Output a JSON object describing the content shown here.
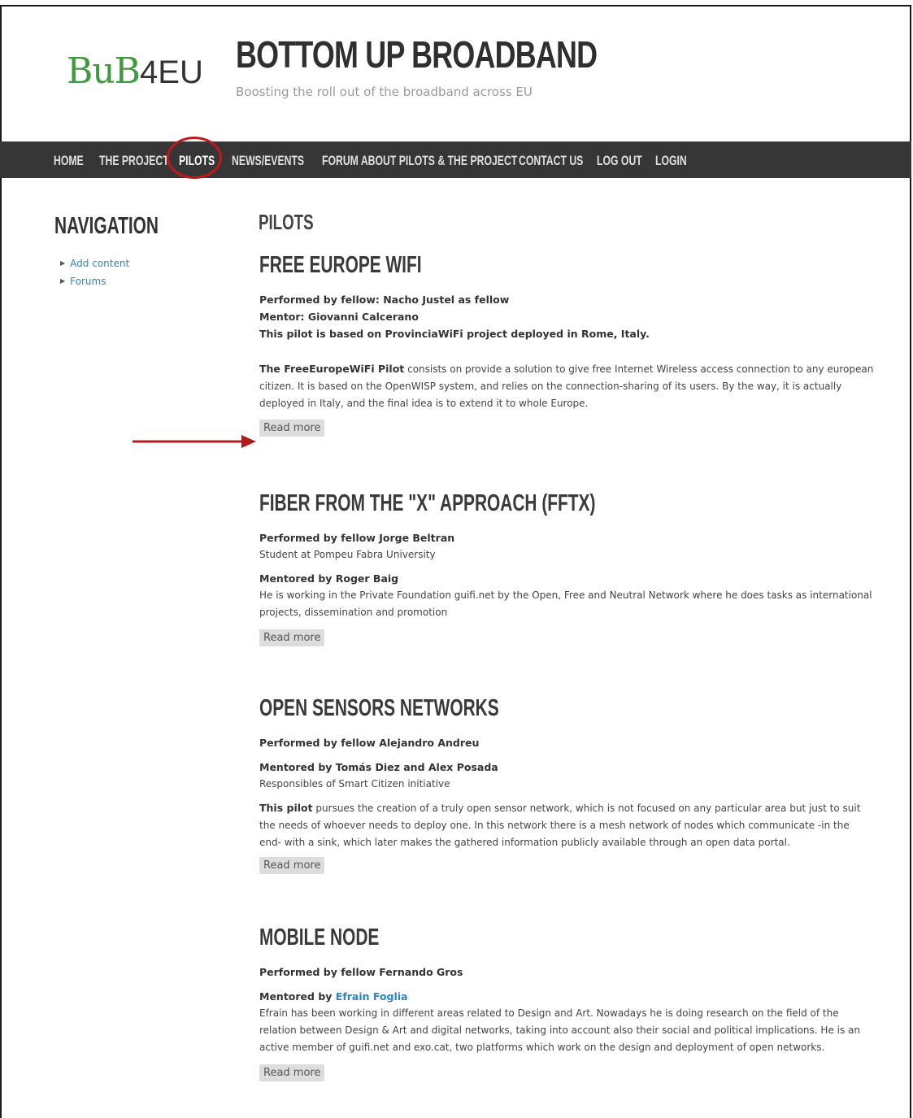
{
  "site": {
    "logo_main": "BuB",
    "logo_suffix": "4EU",
    "title": "BOTTOM UP BROADBAND",
    "slogan": "Boosting the roll out of the broadband across EU"
  },
  "nav": {
    "items": [
      {
        "label": "HOME"
      },
      {
        "label": "THE PROJECT"
      },
      {
        "label": "PILOTS"
      },
      {
        "label": "NEWS/EVENTS"
      },
      {
        "label": "FORUM ABOUT PILOTS & THE PROJECT"
      },
      {
        "label": "CONTACT US"
      },
      {
        "label": "LOG OUT"
      },
      {
        "label": "LOGIN"
      }
    ],
    "active": "PILOTS"
  },
  "sidebar": {
    "title": "NAVIGATION",
    "links": [
      {
        "label": "Add content"
      },
      {
        "label": "Forums"
      }
    ]
  },
  "main": {
    "page_title": "PILOTS",
    "read_more": "Read more",
    "pilots": [
      {
        "title": "FREE EUROPE WIFI",
        "line1": "Performed by fellow: Nacho Justel as fellow",
        "line2": "Mentor: Giovanni Calcerano",
        "line3": "This pilot is based on ProvinciaWiFi project deployed in Rome, Italy.",
        "lead": "The FreeEuropeWiFi Pilot",
        "body": " consists on provide a solution to give free Internet Wireless access connection to any european citizen. It is based on the OpenWISP system, and relies on the connection-sharing of its users. By the way, it is actually deployed in Italy, and the final idea is to extend it to whole Europe."
      },
      {
        "title": "FIBER FROM THE \"X\" APPROACH (FFTX)",
        "performed": "Performed by fellow Jorge Beltran",
        "performed_sub": "Student at Pompeu Fabra University",
        "mentored": "Mentored by Roger Baig",
        "body": "He is working in the Private Foundation guifi.net by the Open, Free and Neutral Network where he does tasks as international projects, dissemination and promotion"
      },
      {
        "title": "OPEN SENSORS NETWORKS",
        "performed": "Performed by fellow Alejandro Andreu",
        "mentored": "Mentored by Tomás Diez and Alex Posada",
        "mentored_sub": "Responsibles of Smart Citizen initiative",
        "lead": "This pilot",
        "body": " pursues the creation of a truly open sensor network, which is not focused on any particular area but just to suit the needs of whoever needs to deploy one. In this network there is a mesh network of nodes which communicate -in the end- with a sink, which later makes the gathered information publicly available through an open data portal."
      },
      {
        "title": "MOBILE NODE",
        "performed": "Performed by fellow Fernando Gros",
        "mentored_prefix": "Mentored by ",
        "mentored_link": "Efrain Foglia",
        "body": "Efrain has been working in different areas related to Design and Art. Nowadays he is doing research on the field of the relation between Design & Art and digital networks, taking into account also their social and political implications. He is an active member of guifi.net and exo.cat, two platforms which work on the design and deployment of open networks."
      }
    ]
  },
  "annotations": {
    "highlight_color": "#c21818"
  }
}
